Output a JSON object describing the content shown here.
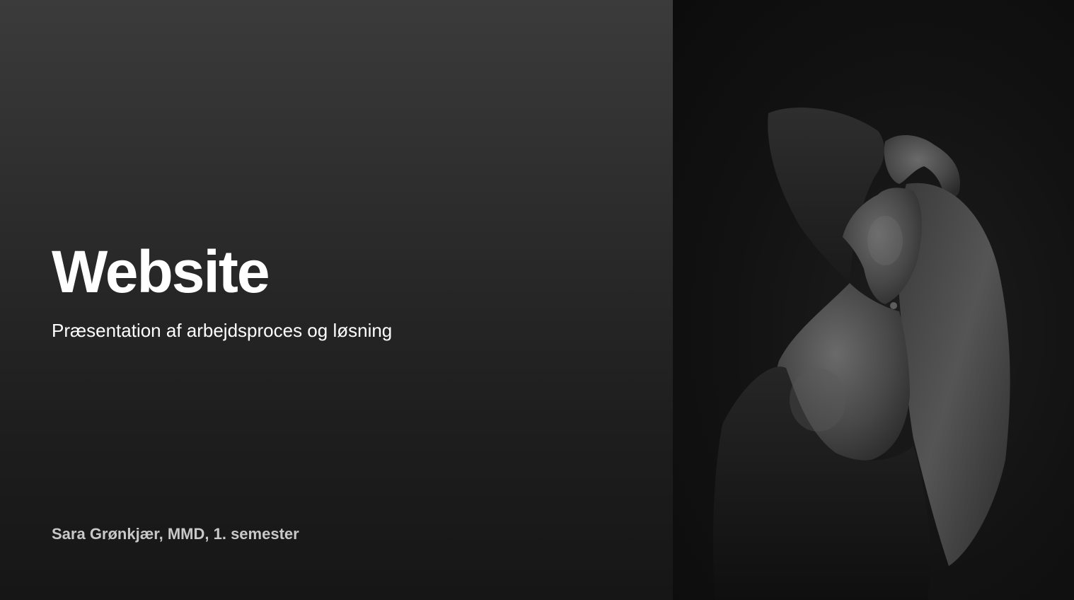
{
  "slide": {
    "title": "Website",
    "subtitle": "Præsentation af arbejdsproces og løsning",
    "author_line": "Sara Grønkjær, MMD, 1. semester"
  },
  "photo": {
    "description_icon": "portrait-photo"
  },
  "colors": {
    "title": "#ffffff",
    "subtitle": "#ffffff",
    "author": "#c8c8c8",
    "left_bg_top": "#3b3b3b",
    "left_bg_bottom": "#161616",
    "right_bg": "#0e0e0e"
  }
}
